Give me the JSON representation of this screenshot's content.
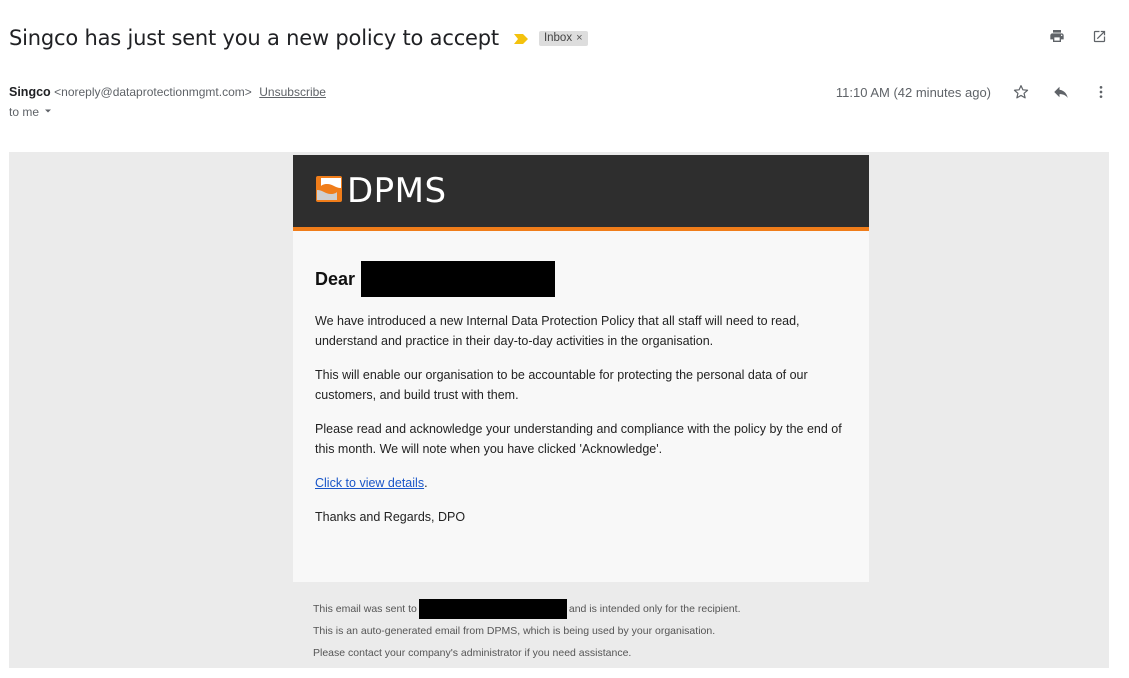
{
  "email": {
    "subject": "Singco has just sent you a new policy to accept",
    "label": "Inbox",
    "label_close": "×",
    "sender_name": "Singco",
    "sender_email": "<noreply@dataprotectionmgmt.com>",
    "unsubscribe": "Unsubscribe",
    "to": "to me",
    "time": "11:10 AM (42 minutes ago)"
  },
  "body": {
    "logo_text": "DPMS",
    "dear": "Dear",
    "para1": "We have introduced a new Internal Data Protection Policy that all staff will need to read, understand and practice in their day-to-day activities in the organisation.",
    "para2": "This will enable our organisation to be accountable for protecting the personal data of our customers, and build trust with them.",
    "para3": "Please read and acknowledge your understanding and compliance with the policy by the end of this month. We will note when you have clicked 'Acknowledge'.",
    "link": "Click to view details",
    "link_suffix": ".",
    "signoff": "Thanks and Regards, DPO"
  },
  "footer": {
    "line1_prefix": "This email was sent to",
    "line1_suffix": "and is intended only for the recipient.",
    "line2": "This is an auto-generated email from DPMS, which is being used by your organisation.",
    "line3": "Please contact your company's administrator if you need assistance."
  },
  "colors": {
    "header_bg": "#2e2e2e",
    "accent_orange": "#f07d1a",
    "importance_yellow": "#f4c20d",
    "link_blue": "#1a56c8",
    "email_bg": "#ebebeb"
  },
  "icons": [
    "importance-marker-icon",
    "print-icon",
    "open-new-window-icon",
    "star-icon",
    "reply-icon",
    "more-vert-icon",
    "chevron-down-icon",
    "dpms-logo-icon"
  ]
}
